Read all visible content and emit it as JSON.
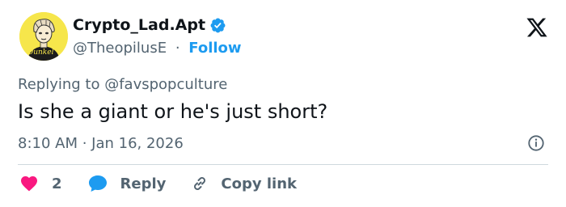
{
  "author": {
    "name": "Crypto_Lad.Apt",
    "handle": "@TheopilusE",
    "separator": "·",
    "follow_label": "Follow"
  },
  "tweet": {
    "replying_to": "Replying to @favspopculture",
    "text": "Is she a giant or he's just short?",
    "timestamp": "8:10 AM · Jan 16, 2026"
  },
  "actions": {
    "like_count": "2",
    "reply_label": "Reply",
    "copy_link_label": "Copy link"
  },
  "icons": {
    "like": "heart-icon",
    "reply": "speech-bubble-icon",
    "copy_link": "link-icon",
    "info": "info-icon",
    "platform": "x-logo-icon",
    "verified": "verified-badge-icon"
  },
  "colors": {
    "accent": "#1d9bf0",
    "like": "#f91880",
    "muted": "#536471",
    "text": "#0f1419",
    "avatar_bg": "#f6e64b"
  }
}
